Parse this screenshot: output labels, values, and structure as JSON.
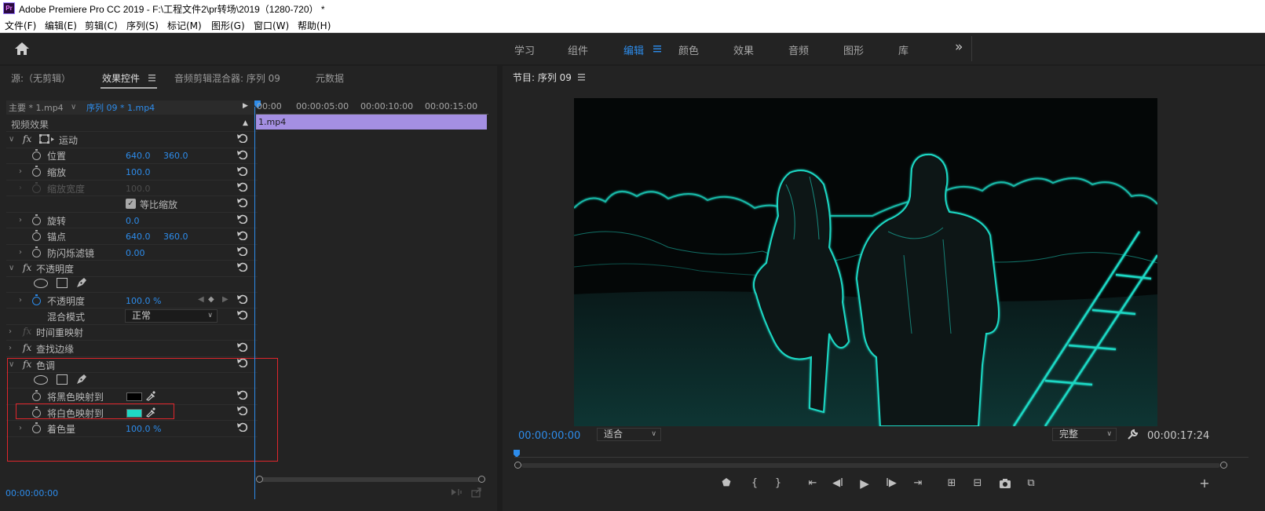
{
  "titlebar": {
    "logo": "Pr",
    "title": "Adobe Premiere Pro CC 2019 - F:\\工程文件2\\pr转场\\2019（1280-720）  *"
  },
  "menu": [
    "文件(F)",
    "编辑(E)",
    "剪辑(C)",
    "序列(S)",
    "标记(M)",
    "图形(G)",
    "窗口(W)",
    "帮助(H)"
  ],
  "workspaces": {
    "items": [
      "学习",
      "组件",
      "编辑",
      "颜色",
      "效果",
      "音频",
      "图形",
      "库"
    ],
    "active": "编辑",
    "more": "»"
  },
  "left_panel": {
    "tabs": [
      "源:（无剪辑）",
      "效果控件",
      "音频剪辑混合器: 序列 09",
      "元数据"
    ],
    "active_tab": "效果控件",
    "master_clip": "主要 * 1.mp4",
    "sequence_clip": "序列 09 * 1.mp4",
    "ruler": [
      "00:00",
      "00:00:05:00",
      "00:00:10:00",
      "00:00:15:00"
    ],
    "clip_name": "1.mp4",
    "section_header": "视频效果",
    "motion": {
      "name": "运动",
      "position_label": "位置",
      "position_x": "640.0",
      "position_y": "360.0",
      "scale_label": "缩放",
      "scale_value": "100.0",
      "scale_width_label": "缩放宽度",
      "scale_width_value": "100.0",
      "uniform_scale_label": "等比缩放",
      "rotation_label": "旋转",
      "rotation_value": "0.0",
      "anchor_label": "锚点",
      "anchor_x": "640.0",
      "anchor_y": "360.0",
      "antiflicker_label": "防闪烁滤镜",
      "antiflicker_value": "0.00"
    },
    "opacity": {
      "name": "不透明度",
      "opacity_label": "不透明度",
      "opacity_value": "100.0 %",
      "blend_label": "混合模式",
      "blend_value": "正常"
    },
    "time_remap": "时间重映射",
    "find_edges": "查找边缘",
    "tint": {
      "name": "色调",
      "map_black_label": "将黑色映射到",
      "map_white_label": "将白色映射到",
      "amount_label": "着色量",
      "amount_value": "100.0 %",
      "black_color": "#000000",
      "white_color": "#1ed8c4"
    },
    "bottom_timecode": "00:00:00:00"
  },
  "program": {
    "title": "节目: 序列 09",
    "timecode": "00:00:00:00",
    "fit": "适合",
    "quality": "完整",
    "duration": "00:00:17:24"
  },
  "colors": {
    "accent": "#2d8ceb",
    "highlight_box": "#e0262c",
    "clip": "#a48fe2"
  }
}
